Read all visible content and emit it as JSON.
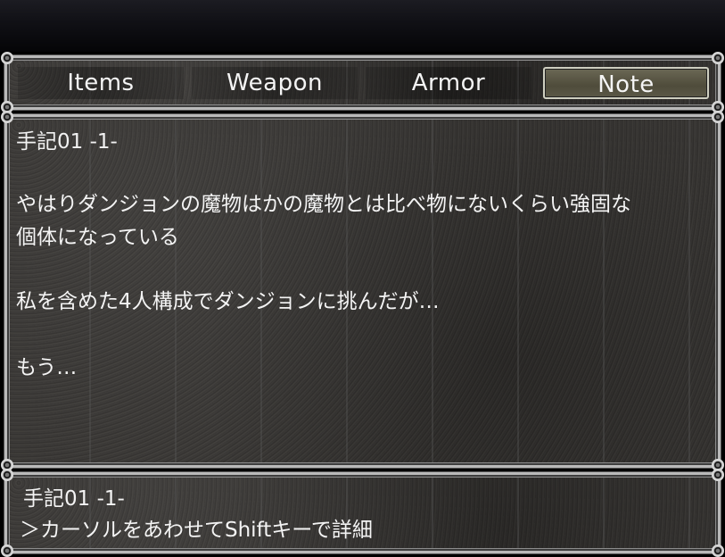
{
  "tabs": [
    {
      "label": "Items",
      "selected": false
    },
    {
      "label": "Weapon",
      "selected": false
    },
    {
      "label": "Armor",
      "selected": false
    },
    {
      "label": "Note",
      "selected": true
    }
  ],
  "note": {
    "title": "手記01 -1-",
    "lines": [
      "やはりダンジョンの魔物はかの魔物とは比べ物にないくらい強固な",
      "個体になっている",
      "私を含めた4人構成でダンジョンに挑んだが…",
      "もう…"
    ]
  },
  "help": {
    "title": "手記01 -1-",
    "hint": "＞カーソルをあわせてShiftキーで詳細"
  },
  "colors": {
    "window_border": "#b9b9b9",
    "window_fill": "#393735",
    "selected_tab": "#5b5847",
    "text": "#f4f4f4"
  }
}
